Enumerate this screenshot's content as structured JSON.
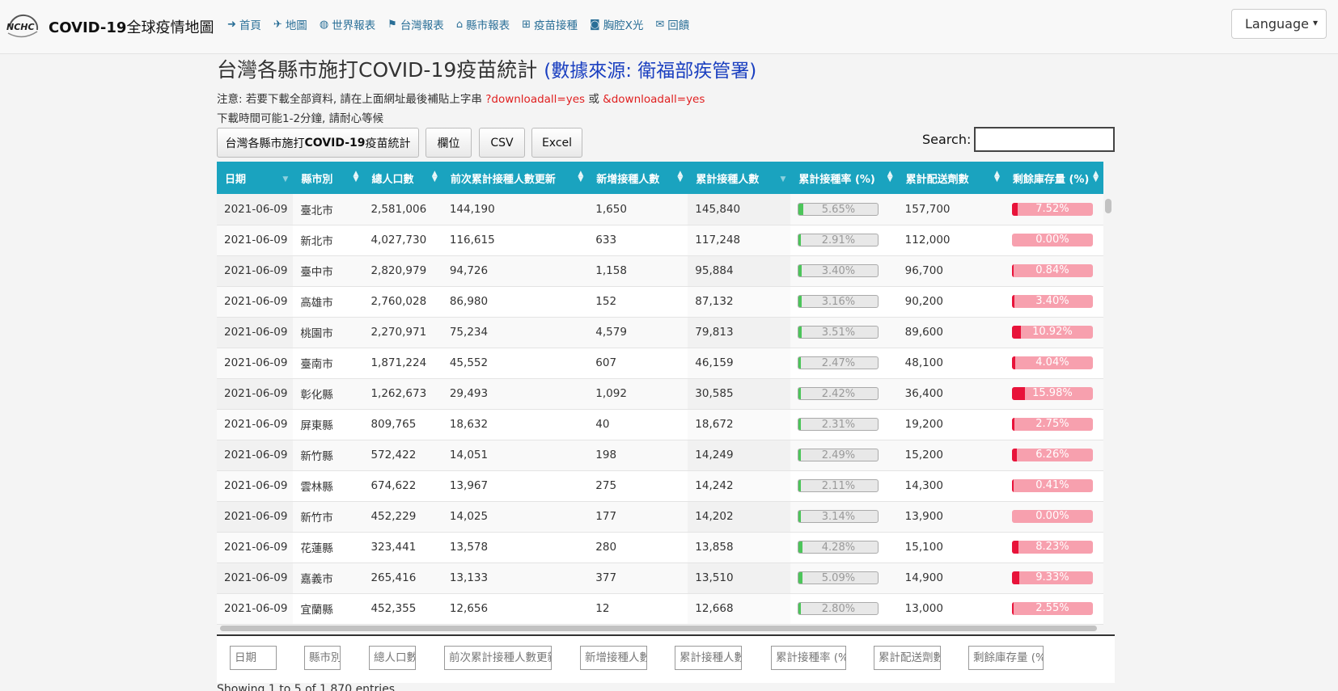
{
  "brand": {
    "logo_text": "NCHC",
    "title_bold": "COVID-19",
    "title_rest": "全球疫情地圖"
  },
  "nav": [
    {
      "icon": "arrow-right-icon",
      "glyph": "➜",
      "label": "首頁"
    },
    {
      "icon": "plane-icon",
      "glyph": "✈",
      "label": "地圖"
    },
    {
      "icon": "globe-icon",
      "glyph": "🌐",
      "label": "世界報表"
    },
    {
      "icon": "flag-icon",
      "glyph": "⚑",
      "label": "台灣報表"
    },
    {
      "icon": "bank-icon",
      "glyph": "🏛",
      "label": "縣市報表"
    },
    {
      "icon": "plus-square-icon",
      "glyph": "⊞",
      "label": "疫苗接種"
    },
    {
      "icon": "camera-icon",
      "glyph": "📷",
      "label": "胸腔X光"
    },
    {
      "icon": "envelope-open-icon",
      "glyph": "✉",
      "label": "回饋"
    }
  ],
  "language": {
    "selected": "Language"
  },
  "page": {
    "title": "台灣各縣市施打COVID-19疫苗統計",
    "source": "(數據來源: 衛福部疾管署)",
    "note_prefix": "注意: 若要下載全部資料, 請在上面網址最後補貼上字串",
    "note_param1": "?downloadall=yes",
    "note_or": "或",
    "note_param2": "&downloadall=yes",
    "note2": "下載時間可能1-2分鐘, 請耐心等候"
  },
  "buttons": {
    "title_btn_pre": "台灣各縣市施打",
    "title_btn_bold": "COVID-19",
    "title_btn_post": "疫苗統計",
    "columns": "欄位",
    "csv": "CSV",
    "excel": "Excel"
  },
  "search": {
    "label": "Search:",
    "value": ""
  },
  "table": {
    "headers": [
      "日期",
      "縣市別",
      "總人口數",
      "前次累計接種人數更新",
      "新增接種人數",
      "累計接種人數",
      "累計接種率 (%)",
      "累計配送劑數",
      "剩餘庫存量 (%)"
    ],
    "rows": [
      [
        "2021-06-09",
        "臺北市",
        "2,581,006",
        "144,190",
        "1,650",
        "145,840",
        "5.65%",
        "157,700",
        "7.52%"
      ],
      [
        "2021-06-09",
        "新北市",
        "4,027,730",
        "116,615",
        "633",
        "117,248",
        "2.91%",
        "112,000",
        "0.00%"
      ],
      [
        "2021-06-09",
        "臺中市",
        "2,820,979",
        "94,726",
        "1,158",
        "95,884",
        "3.40%",
        "96,700",
        "0.84%"
      ],
      [
        "2021-06-09",
        "高雄市",
        "2,760,028",
        "86,980",
        "152",
        "87,132",
        "3.16%",
        "90,200",
        "3.40%"
      ],
      [
        "2021-06-09",
        "桃園市",
        "2,270,971",
        "75,234",
        "4,579",
        "79,813",
        "3.51%",
        "89,600",
        "10.92%"
      ],
      [
        "2021-06-09",
        "臺南市",
        "1,871,224",
        "45,552",
        "607",
        "46,159",
        "2.47%",
        "48,100",
        "4.04%"
      ],
      [
        "2021-06-09",
        "彰化縣",
        "1,262,673",
        "29,493",
        "1,092",
        "30,585",
        "2.42%",
        "36,400",
        "15.98%"
      ],
      [
        "2021-06-09",
        "屏東縣",
        "809,765",
        "18,632",
        "40",
        "18,672",
        "2.31%",
        "19,200",
        "2.75%"
      ],
      [
        "2021-06-09",
        "新竹縣",
        "572,422",
        "14,051",
        "198",
        "14,249",
        "2.49%",
        "15,200",
        "6.26%"
      ],
      [
        "2021-06-09",
        "雲林縣",
        "674,622",
        "13,967",
        "275",
        "14,242",
        "2.11%",
        "14,300",
        "0.41%"
      ],
      [
        "2021-06-09",
        "新竹市",
        "452,229",
        "14,025",
        "177",
        "14,202",
        "3.14%",
        "13,900",
        "0.00%"
      ],
      [
        "2021-06-09",
        "花蓮縣",
        "323,441",
        "13,578",
        "280",
        "13,858",
        "4.28%",
        "15,100",
        "8.23%"
      ],
      [
        "2021-06-09",
        "嘉義市",
        "265,416",
        "13,133",
        "377",
        "13,510",
        "5.09%",
        "14,900",
        "9.33%"
      ],
      [
        "2021-06-09",
        "宜蘭縣",
        "452,355",
        "12,656",
        "12",
        "12,668",
        "2.80%",
        "13,000",
        "2.55%"
      ]
    ],
    "footer_filters": [
      "日期",
      "縣市別",
      "總人口數",
      "前次累計接種人數更新",
      "新增接種人數",
      "累計接種人數",
      "累計接種率 (%)",
      "累計配送劑數",
      "剩餘庫存量 (%)"
    ]
  },
  "status": {
    "showing": "Showing 1 to 5 of 1,870 entries"
  },
  "colors": {
    "header_bg": "#1aa3bf",
    "rate_fill": "#4cc55a",
    "stock_fill": "#e8133a",
    "stock_bg": "#f7a0ae",
    "link": "#2a6f97",
    "source": "#1a3fc0",
    "param": "#e02020"
  }
}
